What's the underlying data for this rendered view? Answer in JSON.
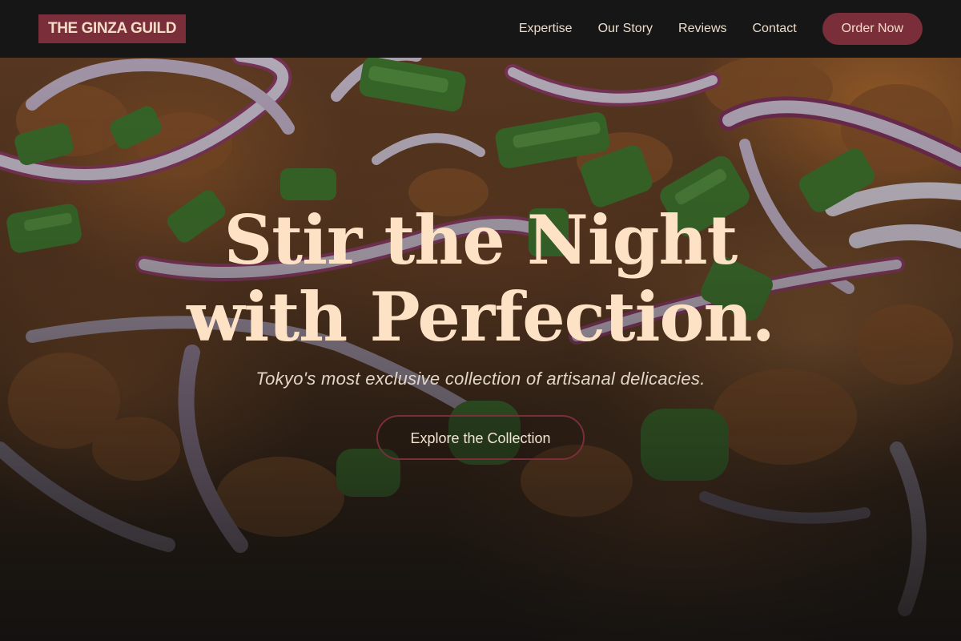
{
  "brand": {
    "logo_text": "THE GINZA GUILD",
    "accent_color": "#7a2e3a",
    "text_color": "#fde2c6",
    "header_bg": "#161616"
  },
  "nav": {
    "links": [
      "Expertise",
      "Our Story",
      "Reviews",
      "Contact"
    ],
    "order_label": "Order Now"
  },
  "hero": {
    "title_line1": "Stir the Night",
    "title_line2": "with Perfection.",
    "subtitle": "Tokyo's most exclusive collection of artisanal delicacies.",
    "cta_label": "Explore the Collection",
    "background": "food-photo-red-onion-scallion"
  }
}
